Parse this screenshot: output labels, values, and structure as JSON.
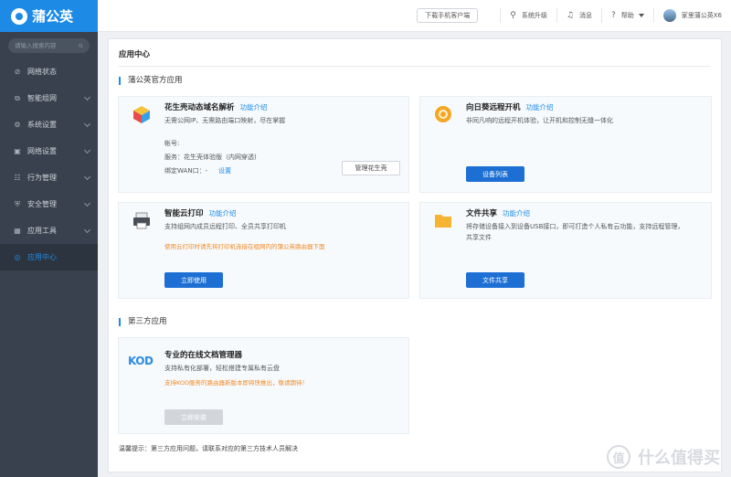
{
  "app": {
    "brand": "蒲公英"
  },
  "search": {
    "placeholder": "请输入搜索内容"
  },
  "sidebar": {
    "items": [
      {
        "label": "网络状态",
        "icon": "network-status-icon"
      },
      {
        "label": "智能组网",
        "icon": "smart-network-icon"
      },
      {
        "label": "系统设置",
        "icon": "system-settings-icon"
      },
      {
        "label": "网络设置",
        "icon": "network-settings-icon"
      },
      {
        "label": "行为管理",
        "icon": "behavior-icon"
      },
      {
        "label": "安全管理",
        "icon": "security-icon"
      },
      {
        "label": "应用工具",
        "icon": "tools-icon"
      },
      {
        "label": "应用中心",
        "icon": "app-center-icon",
        "active": true
      }
    ]
  },
  "topbar": {
    "download_label": "下载手机客户端",
    "upgrade_label": "系统升级",
    "messages_label": "消息",
    "help_label": "帮助",
    "device_label": "家里蒲公英X6"
  },
  "main": {
    "title": "应用中心",
    "official_section": "蒲公英官方应用",
    "third_section": "第三方应用",
    "tip": "温馨提示：第三方应用问题，请联系对应的第三方技术人员解决"
  },
  "cards": {
    "hsk": {
      "title": "花生壳动态域名解析",
      "intro": "功能介绍",
      "desc": "无需公网IP、无需路由端口映射，尽在掌握",
      "account_label": "帐号:",
      "service_label": "服务：",
      "service_value": "花生壳体验版（内网穿透)",
      "wan_label": "绑定WAN口：",
      "wan_value": "-",
      "settings_link": "设置",
      "manage_button": "管理花生壳"
    },
    "sunflower": {
      "title": "向日葵远程开机",
      "intro": "功能介绍",
      "desc": "非同凡响的远程开机体验，让开机和控制无缝一体化",
      "button": "设备列表"
    },
    "print": {
      "title": "智能云打印",
      "intro": "功能介绍",
      "desc": "支持组网内成员远程打印、全员共享打印机",
      "warn": "使用云打印时请先将打印机连接在组网内的蒲公英路由器下面",
      "button": "立即使用"
    },
    "fileshare": {
      "title": "文件共享",
      "intro": "功能介绍",
      "desc1": "将存储设备接入到设备USB接口，即可打造个人私有云功能，支持远程管理，",
      "desc2": "共享文件",
      "button": "文件共享"
    },
    "kod": {
      "logo": "KOD",
      "title": "专业的在线文档管理器",
      "desc": "支持私有化部署，轻松搭建专属私有云盘",
      "warn": "支持KOD服务的路由器新版本即将快推出，敬请期待！",
      "button": "立即安装"
    }
  },
  "watermark": {
    "text": "什么值得买",
    "symbol": "值"
  },
  "colors": {
    "accent": "#1d8ae6",
    "button": "#1d6fd3",
    "sidebar": "#38414d",
    "warn": "#f08a24"
  }
}
